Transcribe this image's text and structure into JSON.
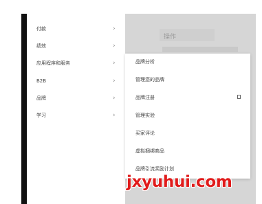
{
  "background": {
    "title": "操作"
  },
  "main_menu": {
    "items": [
      {
        "label": "付款",
        "chevron": "›"
      },
      {
        "label": "绩效",
        "chevron": "›"
      },
      {
        "label": "应用程序和服务",
        "chevron": "›"
      },
      {
        "label": "B2B",
        "chevron": "›"
      },
      {
        "label": "品牌",
        "chevron": "›"
      },
      {
        "label": "学习",
        "chevron": "›"
      }
    ]
  },
  "sub_menu": {
    "items": [
      {
        "label": "品牌分析"
      },
      {
        "label": "管理您的品牌"
      },
      {
        "label": "品牌注册"
      },
      {
        "label": "管理实验"
      },
      {
        "label": "买家评论"
      },
      {
        "label": "虚拟捆绑商品"
      },
      {
        "label": "品牌引流奖励计划"
      }
    ]
  },
  "watermark": {
    "text": "jxyuhui.com"
  },
  "colors": {
    "watermark": "#e01b1b",
    "menu_text": "#444444",
    "background_panel": "#d6d6d6"
  }
}
